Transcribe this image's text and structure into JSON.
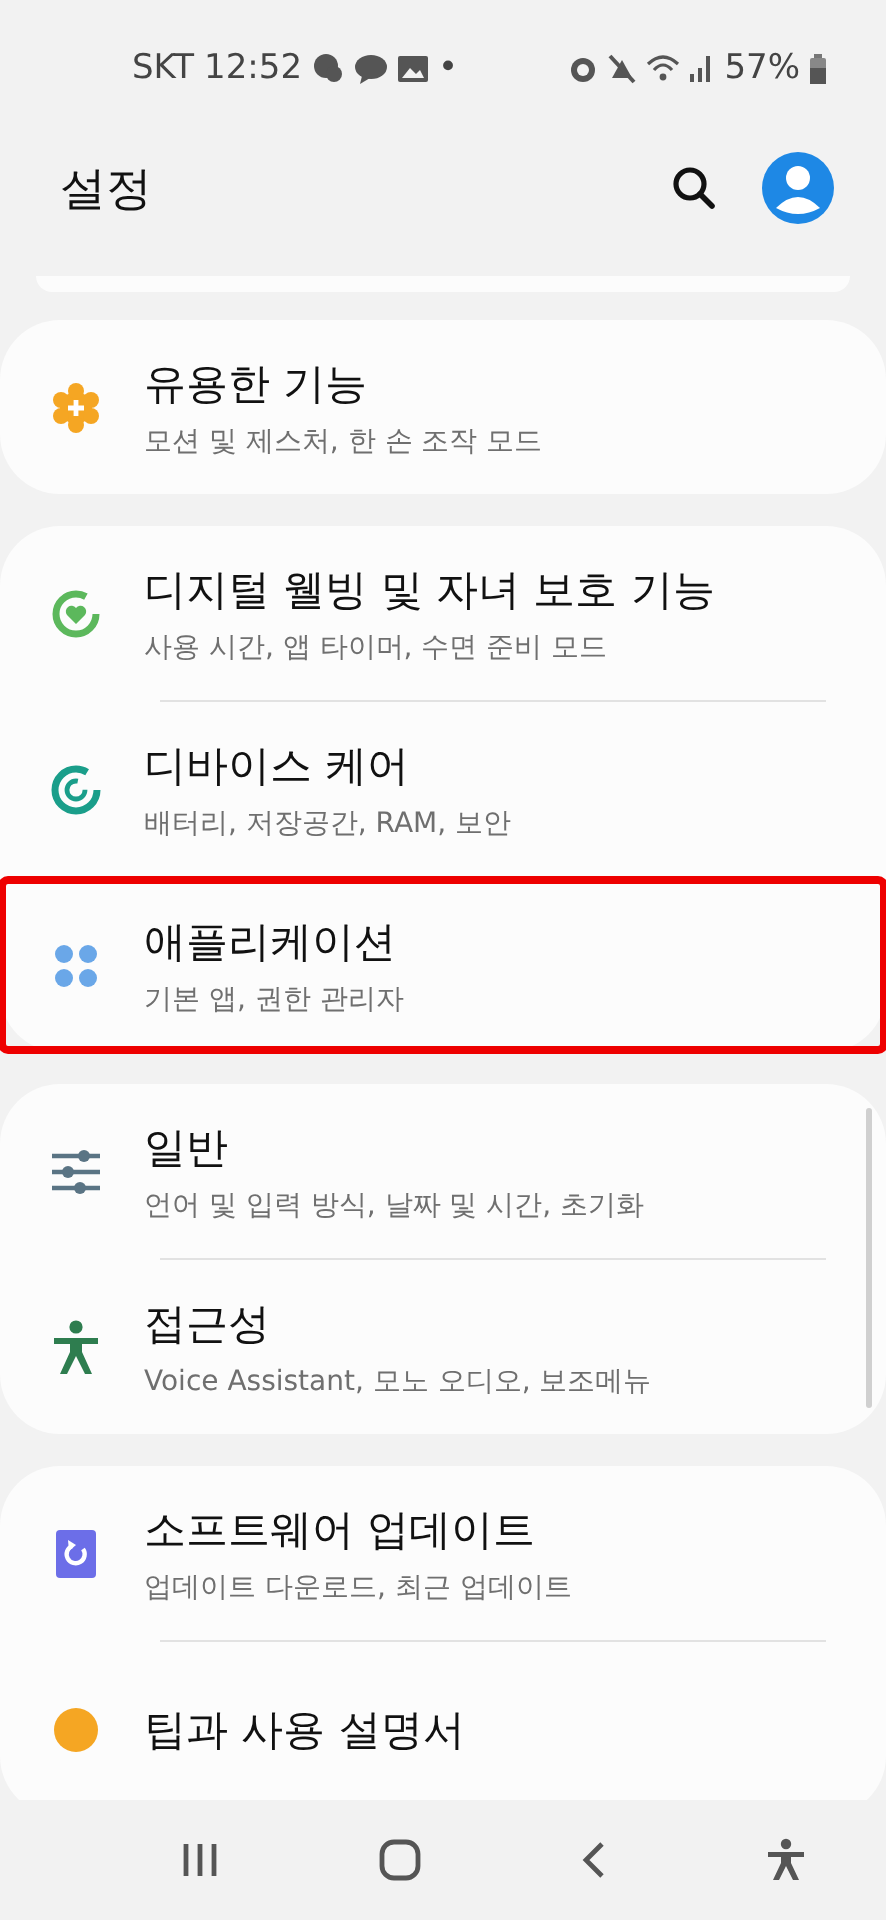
{
  "status_bar": {
    "carrier": "SKT",
    "time": "12:52",
    "dot": "•",
    "battery": "57%"
  },
  "header": {
    "title": "설정"
  },
  "groups": [
    {
      "items": [
        {
          "kind": "advanced",
          "title": "유용한 기능",
          "subtitle": "모션 및 제스처, 한 손 조작 모드",
          "highlighted": false
        }
      ]
    },
    {
      "items": [
        {
          "kind": "wellbeing",
          "title": "디지털 웰빙 및 자녀 보호 기능",
          "subtitle": "사용 시간, 앱 타이머, 수면 준비 모드",
          "highlighted": false
        },
        {
          "kind": "care",
          "title": "디바이스 케어",
          "subtitle": "배터리, 저장공간, RAM, 보안",
          "highlighted": false
        },
        {
          "kind": "apps",
          "title": "애플리케이션",
          "subtitle": "기본 앱, 권한 관리자",
          "highlighted": true
        }
      ]
    },
    {
      "items": [
        {
          "kind": "general",
          "title": "일반",
          "subtitle": "언어 및 입력 방식, 날짜 및 시간, 초기화",
          "highlighted": false
        },
        {
          "kind": "accessibility",
          "title": "접근성",
          "subtitle": "Voice Assistant, 모노 오디오, 보조메뉴",
          "highlighted": false
        }
      ]
    },
    {
      "items": [
        {
          "kind": "update",
          "title": "소프트웨어 업데이트",
          "subtitle": "업데이트 다운로드, 최근 업데이트",
          "highlighted": false
        },
        {
          "kind": "tips",
          "title": "팁과 사용 설명서",
          "highlighted": false
        }
      ]
    }
  ]
}
